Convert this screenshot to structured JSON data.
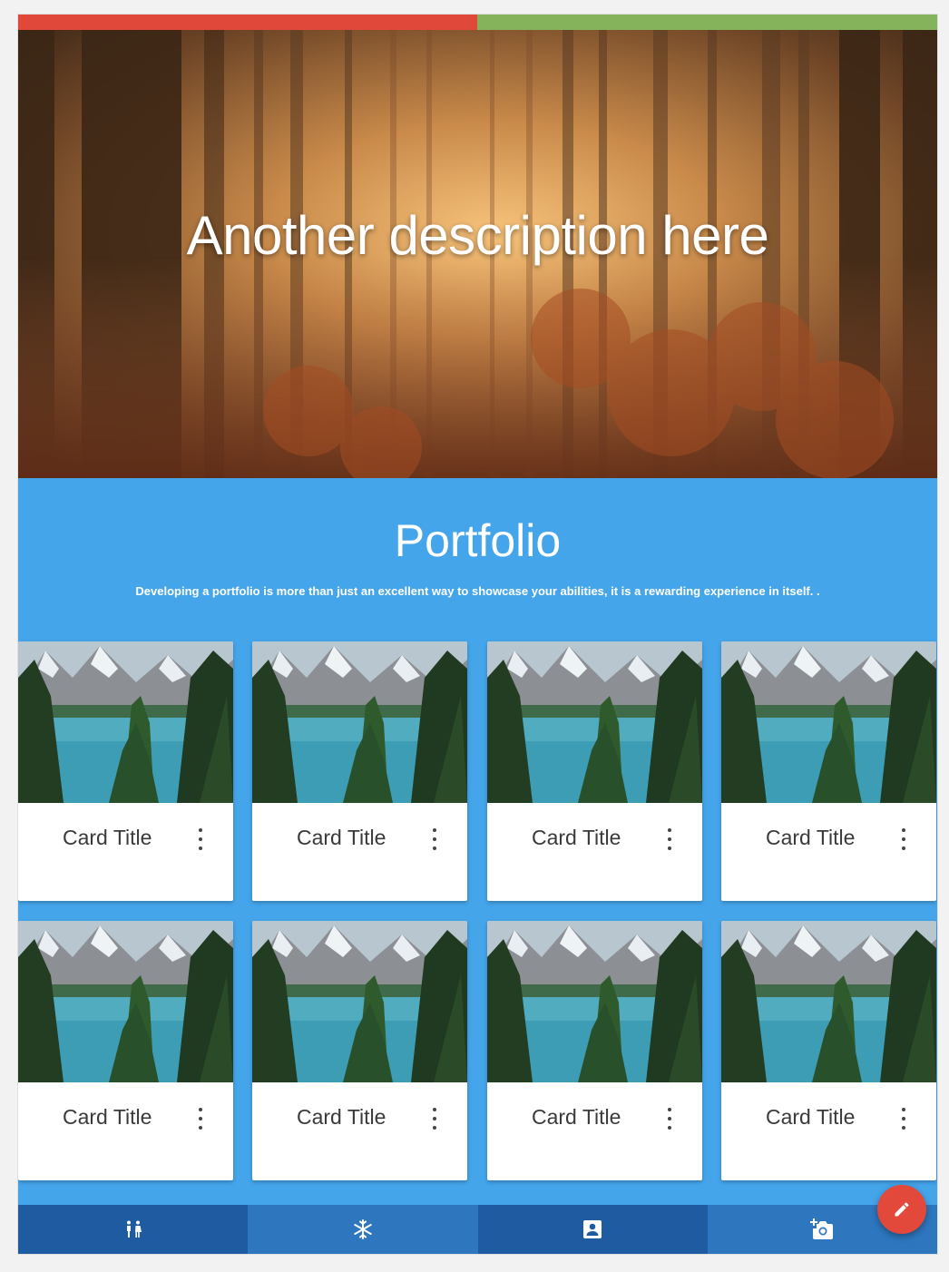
{
  "colors": {
    "bar_left": "#e0493a",
    "bar_right": "#84b35b",
    "portfolio_bg": "#45a5eb",
    "nav_dark": "#1f5ba0",
    "nav_light": "#2e77bf",
    "fab": "#e2493a"
  },
  "hero": {
    "image": "forest-autumn-mist-image",
    "headline": "Another description here"
  },
  "portfolio": {
    "title": "Portfolio",
    "description": "Developing a portfolio is more than just an excellent way to showcase your abilities, it is a rewarding experience in itself. .",
    "cards": [
      {
        "title": "Card Title",
        "image": "mountain-lake-image",
        "menu_icon": "more-vert-icon"
      },
      {
        "title": "Card Title",
        "image": "mountain-lake-image",
        "menu_icon": "more-vert-icon"
      },
      {
        "title": "Card Title",
        "image": "mountain-lake-image",
        "menu_icon": "more-vert-icon"
      },
      {
        "title": "Card Title",
        "image": "mountain-lake-image",
        "menu_icon": "more-vert-icon"
      },
      {
        "title": "Card Title",
        "image": "mountain-lake-image",
        "menu_icon": "more-vert-icon"
      },
      {
        "title": "Card Title",
        "image": "mountain-lake-image",
        "menu_icon": "more-vert-icon"
      },
      {
        "title": "Card Title",
        "image": "mountain-lake-image",
        "menu_icon": "more-vert-icon"
      },
      {
        "title": "Card Title",
        "image": "mountain-lake-image",
        "menu_icon": "more-vert-icon"
      }
    ]
  },
  "bottom_nav": {
    "items": [
      {
        "icon": "wc-people-icon"
      },
      {
        "icon": "snowflake-icon"
      },
      {
        "icon": "contact-card-icon"
      },
      {
        "icon": "add-camera-icon"
      }
    ]
  },
  "fab": {
    "icon": "pencil-edit-icon"
  }
}
